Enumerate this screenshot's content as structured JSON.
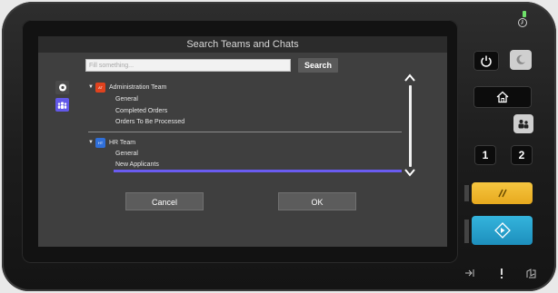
{
  "title": "Search Teams and Chats",
  "search": {
    "placeholder": "Fill something...",
    "button_label": "Search"
  },
  "teams": [
    {
      "initials": "AT",
      "name": "Administration Team",
      "badge_color": "#e0421e",
      "channels": [
        "General",
        "Completed Orders",
        "Orders To Be Processed"
      ]
    },
    {
      "initials": "HT",
      "name": "HR Team",
      "badge_color": "#2f6fd9",
      "channels": [
        "General",
        "New Applicants"
      ]
    }
  ],
  "selected_channel": "New Applicants",
  "dialog": {
    "cancel_label": "Cancel",
    "ok_label": "OK"
  },
  "hardware": {
    "numbers": [
      "1",
      "2"
    ],
    "status_led_color": "#6fe16a",
    "accent_yellow": "#f2b830",
    "accent_blue": "#27a6d4"
  }
}
